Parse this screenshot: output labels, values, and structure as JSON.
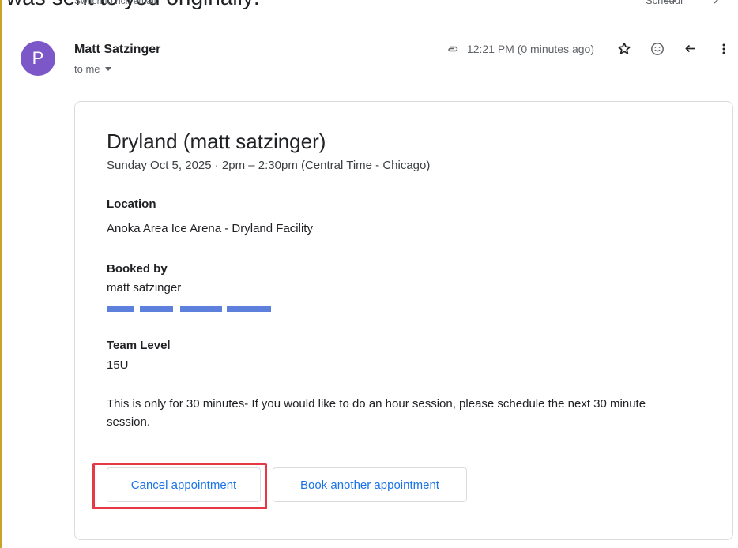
{
  "page": {
    "top_clip_text": "was sent to you originally:",
    "top_clip_small": "Switch to rich email",
    "top_right_clip": "Schedul"
  },
  "email": {
    "sender": {
      "avatar_letter": "P",
      "name": "Matt Satzinger",
      "recipient": "to me"
    },
    "header": {
      "time": "12:21 PM (0 minutes ago)",
      "attachment_icon": "paperclip-icon",
      "star_icon": "star-icon",
      "emoji_icon": "smile-icon",
      "reply_icon": "reply-icon",
      "more_icon": "more-vertical-icon"
    }
  },
  "event": {
    "title": "Dryland (matt satzinger)",
    "date_time": "Sunday Oct 5, 2025 · 2pm – 2:30pm (Central Time - Chicago)",
    "location_label": "Location",
    "location": "Anoka Area Ice Arena - Dryland Facility",
    "booked_by_label": "Booked by",
    "booked_by": "matt satzinger",
    "team_level_label": "Team Level",
    "team_level": "15U",
    "note": "This is only for 30 minutes- If you would like to do an hour session, please schedule the next 30 minute session.",
    "cancel_label": "Cancel appointment",
    "book_label": "Book another appointment"
  },
  "colors": {
    "accent_blue": "#1a73e8",
    "avatar_purple": "#7b57c7",
    "highlight_red": "#e53946",
    "redaction_blue": "#1f4fcf"
  }
}
